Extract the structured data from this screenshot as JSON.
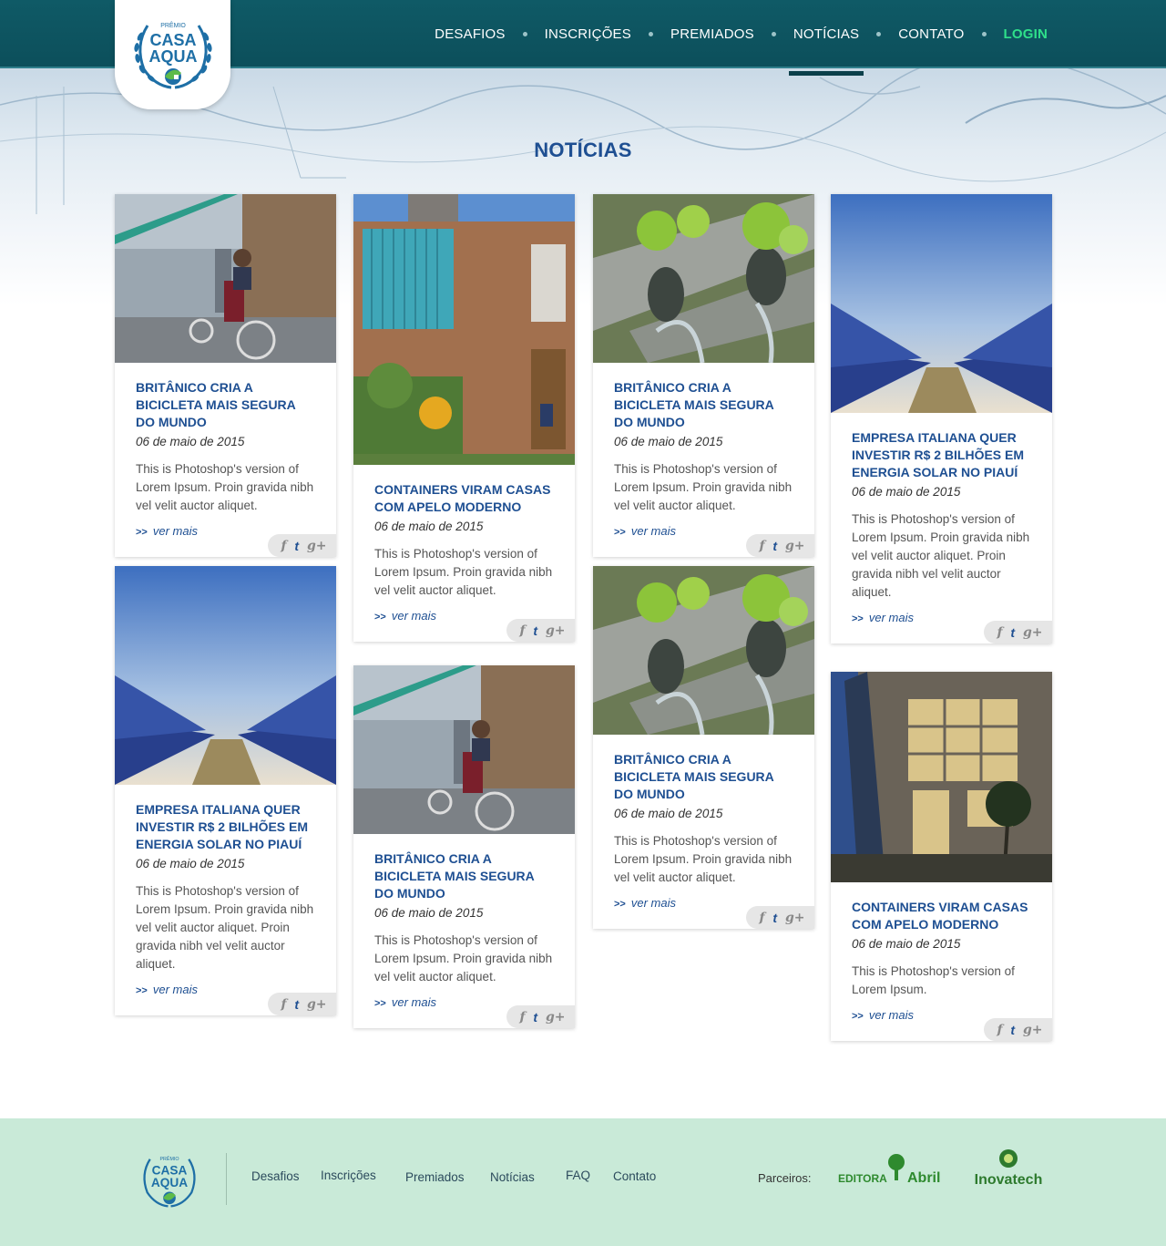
{
  "brand": {
    "name_top": "PRÊMIO",
    "name_line1": "CASA",
    "name_line2": "AQUA"
  },
  "nav": {
    "items": [
      {
        "label": "DESAFIOS"
      },
      {
        "label": "INSCRIÇÕES"
      },
      {
        "label": "PREMIADOS"
      },
      {
        "label": "NOTÍCIAS"
      },
      {
        "label": "CONTATO"
      }
    ],
    "login": "LOGIN",
    "active": "NOTÍCIAS"
  },
  "page": {
    "title": "NOTÍCIAS"
  },
  "cards": [
    {
      "image": "bicycle-photo",
      "title": "BRITÂNICO CRIA A BICICLETA MAIS SEGURA DO MUNDO",
      "date": "06 de maio de 2015",
      "text": "This is Photoshop's version of Lorem Ipsum. Proin gravida nibh vel velit auctor aliquet.",
      "more": "ver mais"
    },
    {
      "image": "container-house-photo",
      "title": "CONTAINERS VIRAM CASAS COM APELO MODERNO",
      "date": "06 de maio de 2015",
      "text": "This is Photoshop's version of Lorem Ipsum. Proin gravida nibh vel velit auctor aliquet.",
      "more": "ver mais"
    },
    {
      "image": "hydroponics-photo",
      "title": "BRITÂNICO CRIA A BICICLETA MAIS SEGURA DO MUNDO",
      "date": "06 de maio de 2015",
      "text": "This is Photoshop's version of Lorem Ipsum. Proin gravida nibh vel velit auctor aliquet.",
      "more": "ver mais"
    },
    {
      "image": "solar-panels-photo",
      "title": "EMPRESA ITALIANA QUER INVESTIR R$ 2 BILHÕES EM ENERGIA SOLAR NO PIAUÍ",
      "date": "06 de maio de 2015",
      "text": "This is Photoshop's version of Lorem Ipsum. Proin gravida nibh vel velit auctor aliquet. Proin gravida nibh vel velit auctor aliquet.",
      "more": "ver mais"
    },
    {
      "image": "solar-panels-photo",
      "title": "EMPRESA ITALIANA QUER INVESTIR R$ 2 BILHÕES EM ENERGIA SOLAR NO PIAUÍ",
      "date": "06 de maio de 2015",
      "text": "This is Photoshop's version of Lorem Ipsum. Proin gravida nibh vel velit auctor aliquet. Proin gravida nibh vel velit auctor aliquet.",
      "more": "ver mais"
    },
    {
      "image": "bicycle-photo",
      "title": "BRITÂNICO CRIA A BICICLETA MAIS SEGURA DO MUNDO",
      "date": "06 de maio de 2015",
      "text": "This is Photoshop's version of Lorem Ipsum. Proin gravida nibh vel velit auctor aliquet.",
      "more": "ver mais"
    },
    {
      "image": "hydroponics-photo",
      "title": "BRITÂNICO CRIA A BICICLETA MAIS SEGURA DO MUNDO",
      "date": "06 de maio de 2015",
      "text": "This is Photoshop's version of Lorem Ipsum. Proin gravida nibh vel velit auctor aliquet.",
      "more": "ver mais"
    },
    {
      "image": "building-photo",
      "title": "CONTAINERS VIRAM CASAS COM APELO MODERNO",
      "date": "06 de maio de 2015",
      "text": "This is Photoshop's version of Lorem Ipsum.",
      "more": "ver mais"
    }
  ],
  "social": {
    "facebook": "f",
    "twitter": "t",
    "googleplus": "g+"
  },
  "footer": {
    "links": [
      {
        "label": "Desafios"
      },
      {
        "label": "Inscrições"
      },
      {
        "label": "Premiados"
      },
      {
        "label": "Notícias"
      },
      {
        "label": "FAQ"
      },
      {
        "label": "Contato"
      }
    ],
    "partners_label": "Parceiros:",
    "partner1_prefix": "EDITORA",
    "partner1_name": "Abril",
    "partner2_name": "Inovatech"
  },
  "colors": {
    "header": "#0f5a66",
    "title_blue": "#1e4f92",
    "login_green": "#2fe08a",
    "footer_bg": "#c9ead8"
  }
}
